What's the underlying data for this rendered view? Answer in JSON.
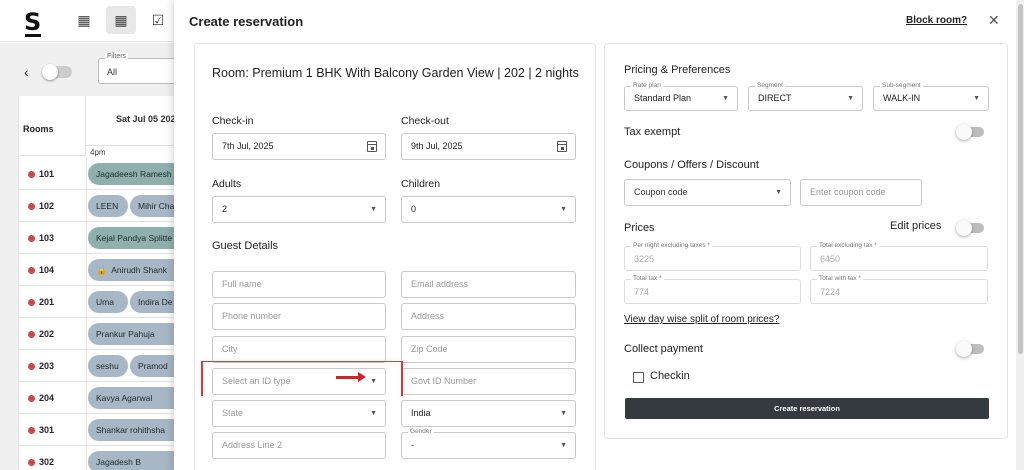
{
  "background": {
    "logo": "S",
    "filter_label": "Filters",
    "filter_value": "All",
    "rooms_header": "Rooms",
    "date_header": "Sat Jul 05 202",
    "time_label": "4pm",
    "rooms": [
      {
        "name": "101",
        "bookings": [
          "Jagadeesh Ramesh"
        ]
      },
      {
        "name": "102",
        "bookings": [
          "LEEN",
          "Mihir Cha"
        ]
      },
      {
        "name": "103",
        "bookings": [
          "Kejal Pandya Splitte"
        ]
      },
      {
        "name": "104",
        "bookings": [
          "Anirudh Shank"
        ]
      },
      {
        "name": "201",
        "bookings": [
          "Uma",
          "Indira De"
        ]
      },
      {
        "name": "202",
        "bookings": [
          "Prankur Pahuja"
        ]
      },
      {
        "name": "203",
        "bookings": [
          "seshu",
          "Pramod"
        ]
      },
      {
        "name": "204",
        "bookings": [
          "Kavya Agarwal"
        ]
      },
      {
        "name": "301",
        "bookings": [
          "Shankar rohithsha"
        ]
      },
      {
        "name": "302",
        "bookings": [
          "Jagadesh B"
        ]
      }
    ]
  },
  "modal": {
    "title": "Create reservation",
    "block_room_link": "Block room?",
    "close": "✕"
  },
  "left": {
    "room_title": "Room: Premium 1 BHK With Balcony Garden View | 202 | 2 nights",
    "checkin_label": "Check-in",
    "checkin_value": "7th Jul, 2025",
    "checkout_label": "Check-out",
    "checkout_value": "9th Jul, 2025",
    "adults_label": "Adults",
    "adults_value": "2",
    "children_label": "Children",
    "children_value": "0",
    "guest_details": "Guest Details",
    "full_name": "Full name",
    "email": "Email address",
    "phone": "Phone number",
    "address": "Address",
    "city": "City",
    "zip": "Zip Code",
    "id_type": "Select an ID type",
    "govt_id": "Govt ID Number",
    "state": "State",
    "country": "India",
    "address_line2": "Address Line 2",
    "gender_label": "Gender",
    "gender_value": "-"
  },
  "right": {
    "pricing_head": "Pricing & Preferences",
    "rate_plan_label": "Rate plan",
    "rate_plan_value": "Standard Plan",
    "segment_label": "Segment",
    "segment_value": "DIRECT",
    "subsegment_label": "Sub-segment",
    "subsegment_value": "WALK-IN",
    "tax_exempt": "Tax exempt",
    "coupons_head": "Coupons / Offers / Discount",
    "coupon_code_select": "Coupon code",
    "coupon_code_input": "Enter coupon code",
    "prices_head": "Prices",
    "edit_prices": "Edit prices",
    "per_night_label": "Per night excluding taxes *",
    "per_night_value": "3225",
    "total_excl_label": "Total excluding tax *",
    "total_excl_value": "6450",
    "total_tax_label": "Total tax *",
    "total_tax_value": "774",
    "total_with_tax_label": "Total with tax *",
    "total_with_tax_value": "7224",
    "view_split_link": "View day wise split of room prices?",
    "collect_payment": "Collect payment",
    "checkin_label": "Checkin",
    "create_button": "Create reservation"
  },
  "colors": {
    "booking_teal": "#8fb1ae",
    "booking_blue": "#a7b7c6",
    "room_dot": "#d04545",
    "annotation_red": "#e2353a",
    "button_dark": "#343a40"
  }
}
